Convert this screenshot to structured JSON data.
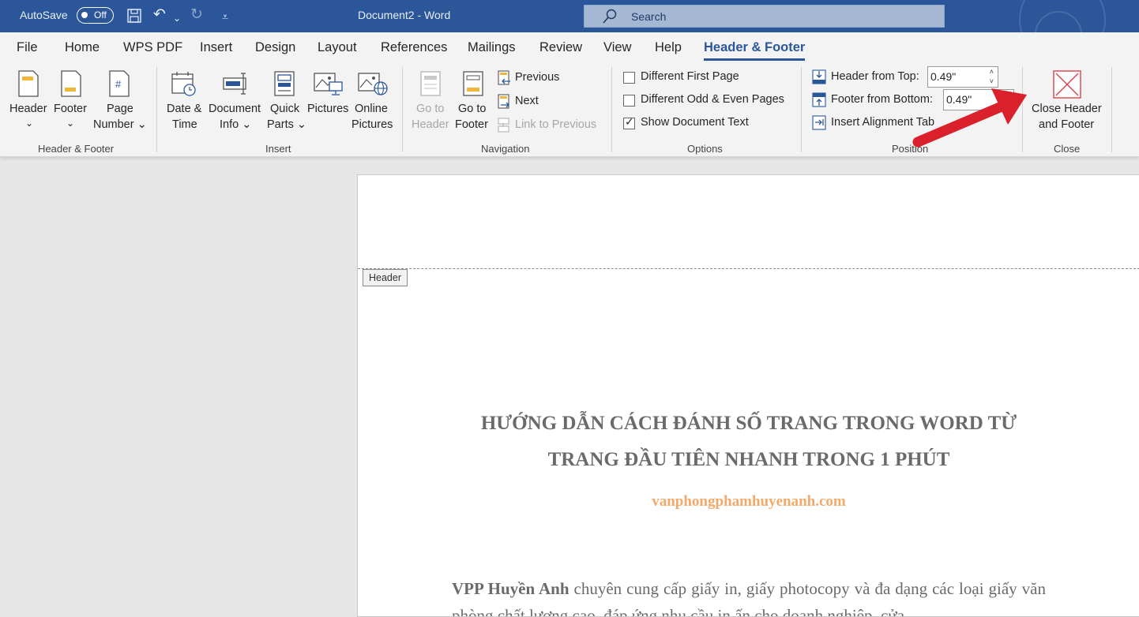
{
  "titlebar": {
    "autosave_label": "AutoSave",
    "autosave_state": "Off",
    "document_title": "Document2  -  Word",
    "search_placeholder": "Search",
    "colors": {
      "titlebar": "#2b579a",
      "search": "#a4b7d3"
    }
  },
  "tabs": [
    {
      "label": "File",
      "active": false
    },
    {
      "label": "Home",
      "active": false
    },
    {
      "label": "WPS PDF",
      "active": false
    },
    {
      "label": "Insert",
      "active": false
    },
    {
      "label": "Design",
      "active": false
    },
    {
      "label": "Layout",
      "active": false
    },
    {
      "label": "References",
      "active": false
    },
    {
      "label": "Mailings",
      "active": false
    },
    {
      "label": "Review",
      "active": false
    },
    {
      "label": "View",
      "active": false
    },
    {
      "label": "Help",
      "active": false
    },
    {
      "label": "Header & Footer",
      "active": true
    }
  ],
  "ribbon": {
    "header_footer_group": {
      "label": "Header & Footer",
      "header": [
        "Header",
        "⌄"
      ],
      "footer": [
        "Footer",
        "⌄"
      ],
      "page_number": [
        "Page",
        "Number ⌄"
      ]
    },
    "insert_group": {
      "label": "Insert",
      "date_time": [
        "Date &",
        "Time"
      ],
      "document_info": [
        "Document",
        "Info ⌄"
      ],
      "quick_parts": [
        "Quick",
        "Parts ⌄"
      ],
      "pictures": [
        "Pictures"
      ],
      "online_pictures": [
        "Online",
        "Pictures"
      ]
    },
    "navigation_group": {
      "label": "Navigation",
      "go_to_header": [
        "Go to",
        "Header"
      ],
      "go_to_footer": [
        "Go to",
        "Footer"
      ],
      "previous": "Previous",
      "next": "Next",
      "link_to_previous": "Link to Previous"
    },
    "options_group": {
      "label": "Options",
      "different_first_page": {
        "label": "Different First Page",
        "checked": false
      },
      "different_odd_even": {
        "label": "Different Odd & Even Pages",
        "checked": false
      },
      "show_document_text": {
        "label": "Show Document Text",
        "checked": true
      }
    },
    "position_group": {
      "label": "Position",
      "header_from_top": {
        "label": "Header from Top:",
        "value": "0.49\""
      },
      "footer_from_bottom": {
        "label": "Footer from Bottom:",
        "value": "0.49\""
      },
      "insert_alignment_tab": "Insert Alignment Tab"
    },
    "close_group": {
      "label": "Close",
      "close_header_footer": [
        "Close Header",
        "and Footer"
      ]
    }
  },
  "document": {
    "header_tag": "Header",
    "heading_line1": "HƯỚNG DẪN CÁCH ĐÁNH SỐ TRANG TRONG WORD TỪ",
    "heading_line2": "TRANG ĐẦU TIÊN NHANH TRONG 1 PHÚT",
    "site": "vanphongphamhuyenanh.com",
    "body_bold": "VPP Huyền Anh",
    "body_rest": " chuyên cung cấp giấy in, giấy photocopy và đa dạng các loại giấy văn phòng chất lượng cao, đáp ứng nhu cầu in ấn cho doanh nghiệp, cửa"
  },
  "annotation": {
    "arrow_color": "#d9202b",
    "points_to": "Close Header and Footer"
  }
}
